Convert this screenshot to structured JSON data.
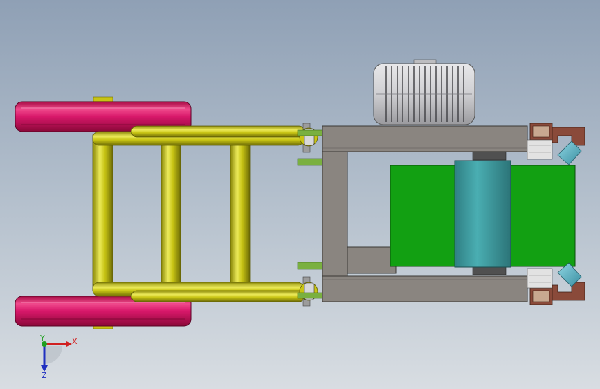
{
  "triad": {
    "x_label": "X",
    "y_label": "Y",
    "z_label": "Z"
  },
  "colors": {
    "wheel": "#c8145a",
    "frame": "#c8c414",
    "chassis": "#8a8580",
    "drum_green": "#12a012",
    "drum_teal": "#3a9a9e",
    "motor": "#cfcfd2",
    "bracket": "#8a4a3a",
    "nozzle": "#5ab4c6",
    "tab_green": "#7ab040",
    "x_axis": "#d02020",
    "y_axis": "#20a020",
    "z_axis": "#2030c0"
  }
}
